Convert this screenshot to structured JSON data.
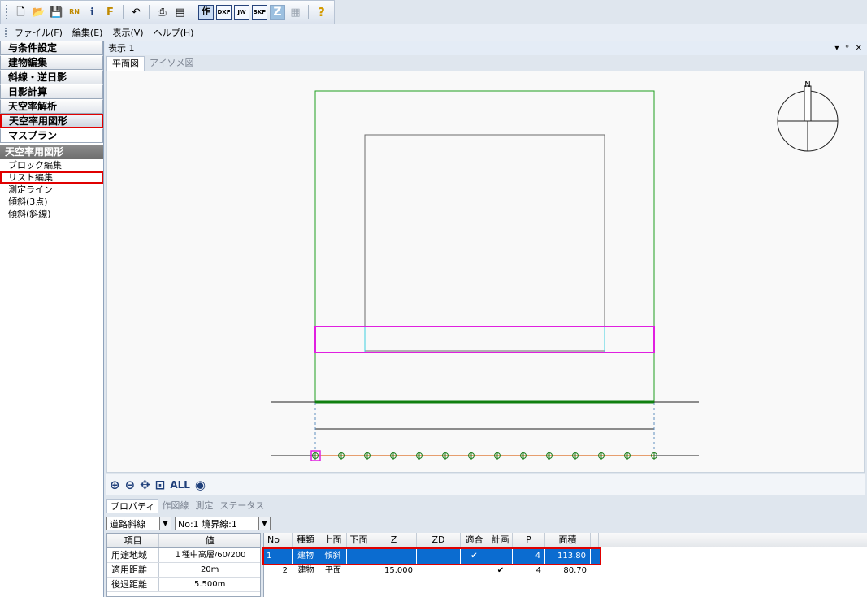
{
  "toolbar": {
    "buttons": [
      {
        "name": "new-file-icon",
        "glyph": "🗋"
      },
      {
        "name": "open-folder-icon",
        "glyph": "📂"
      },
      {
        "name": "save-icon",
        "glyph": "💾"
      },
      {
        "name": "save-rn-icon",
        "glyph": "RN"
      },
      {
        "name": "info-icon",
        "glyph": "i"
      },
      {
        "name": "font-icon",
        "glyph": "F"
      },
      {
        "name": "undo-icon",
        "glyph": "↶"
      },
      {
        "name": "print-icon",
        "glyph": "⎙"
      },
      {
        "name": "layout-icon",
        "glyph": "▤"
      }
    ],
    "mode_buttons": [
      "作",
      "DXF",
      "JW",
      "SKP"
    ],
    "z_button": "Z",
    "help_glyph": "?"
  },
  "menubar": {
    "items": [
      "ファイル(F)",
      "編集(E)",
      "表示(V)",
      "ヘルプ(H)"
    ]
  },
  "sidebar": {
    "categories": [
      "与条件設定",
      "建物編集",
      "斜線・逆日影",
      "日影計算",
      "天空率解析",
      "天空率用図形",
      "マスプラン"
    ],
    "active_category_index": 5,
    "section_title": "天空率用図形",
    "items": [
      "ブロック編集",
      "リスト編集",
      "測定ライン",
      "傾斜(3点)",
      "傾斜(斜線)"
    ],
    "highlighted_item_index": 1
  },
  "view": {
    "title": "表示 1",
    "controls": [
      "▾",
      "ᵠ",
      "✕"
    ],
    "tabs": [
      "平面図",
      "アイソメ図"
    ],
    "active_tab_index": 0,
    "north_label": "N",
    "zoom_tools": [
      {
        "name": "zoom-in-icon",
        "glyph": "⊕"
      },
      {
        "name": "zoom-out-icon",
        "glyph": "⊖"
      },
      {
        "name": "pan-icon",
        "glyph": "✥"
      },
      {
        "name": "zoom-window-icon",
        "glyph": "⊡"
      }
    ],
    "zoom_all_label": "ALL",
    "eye_glyph": "◉"
  },
  "bottom": {
    "tabs": [
      "プロパティ",
      "作図線",
      "測定",
      "ステータス"
    ],
    "active_tab_index": 0,
    "filter_type": "道路斜線",
    "filter_boundary": "No:1 境界線:1",
    "properties": {
      "headers": [
        "項目",
        "値"
      ],
      "rows": [
        [
          "用途地域",
          "１種中高層/60/200"
        ],
        [
          "適用距離",
          "20m"
        ],
        [
          "後退距離",
          "5.500m"
        ]
      ]
    },
    "list": {
      "headers": [
        "No",
        "種類",
        "上面",
        "下面",
        "Z",
        "ZD",
        "適合",
        "計画",
        "P",
        "面積"
      ],
      "rows": [
        [
          "1",
          "建物",
          "傾斜",
          "",
          "",
          "",
          "✔",
          "",
          "4",
          "113.80"
        ],
        [
          "2",
          "建物",
          "平面",
          "",
          "15.000",
          "",
          "",
          "✔",
          "4",
          "80.70"
        ]
      ],
      "selected_row_index": 0
    }
  },
  "colors": {
    "site_boundary": "#20a020",
    "building": "#6a6a6a",
    "selection": "#e020e0",
    "road_line": "#202020",
    "measure_line": "#e08040",
    "highlight_red": "#e00000",
    "selection_blue": "#0b6cd0"
  }
}
